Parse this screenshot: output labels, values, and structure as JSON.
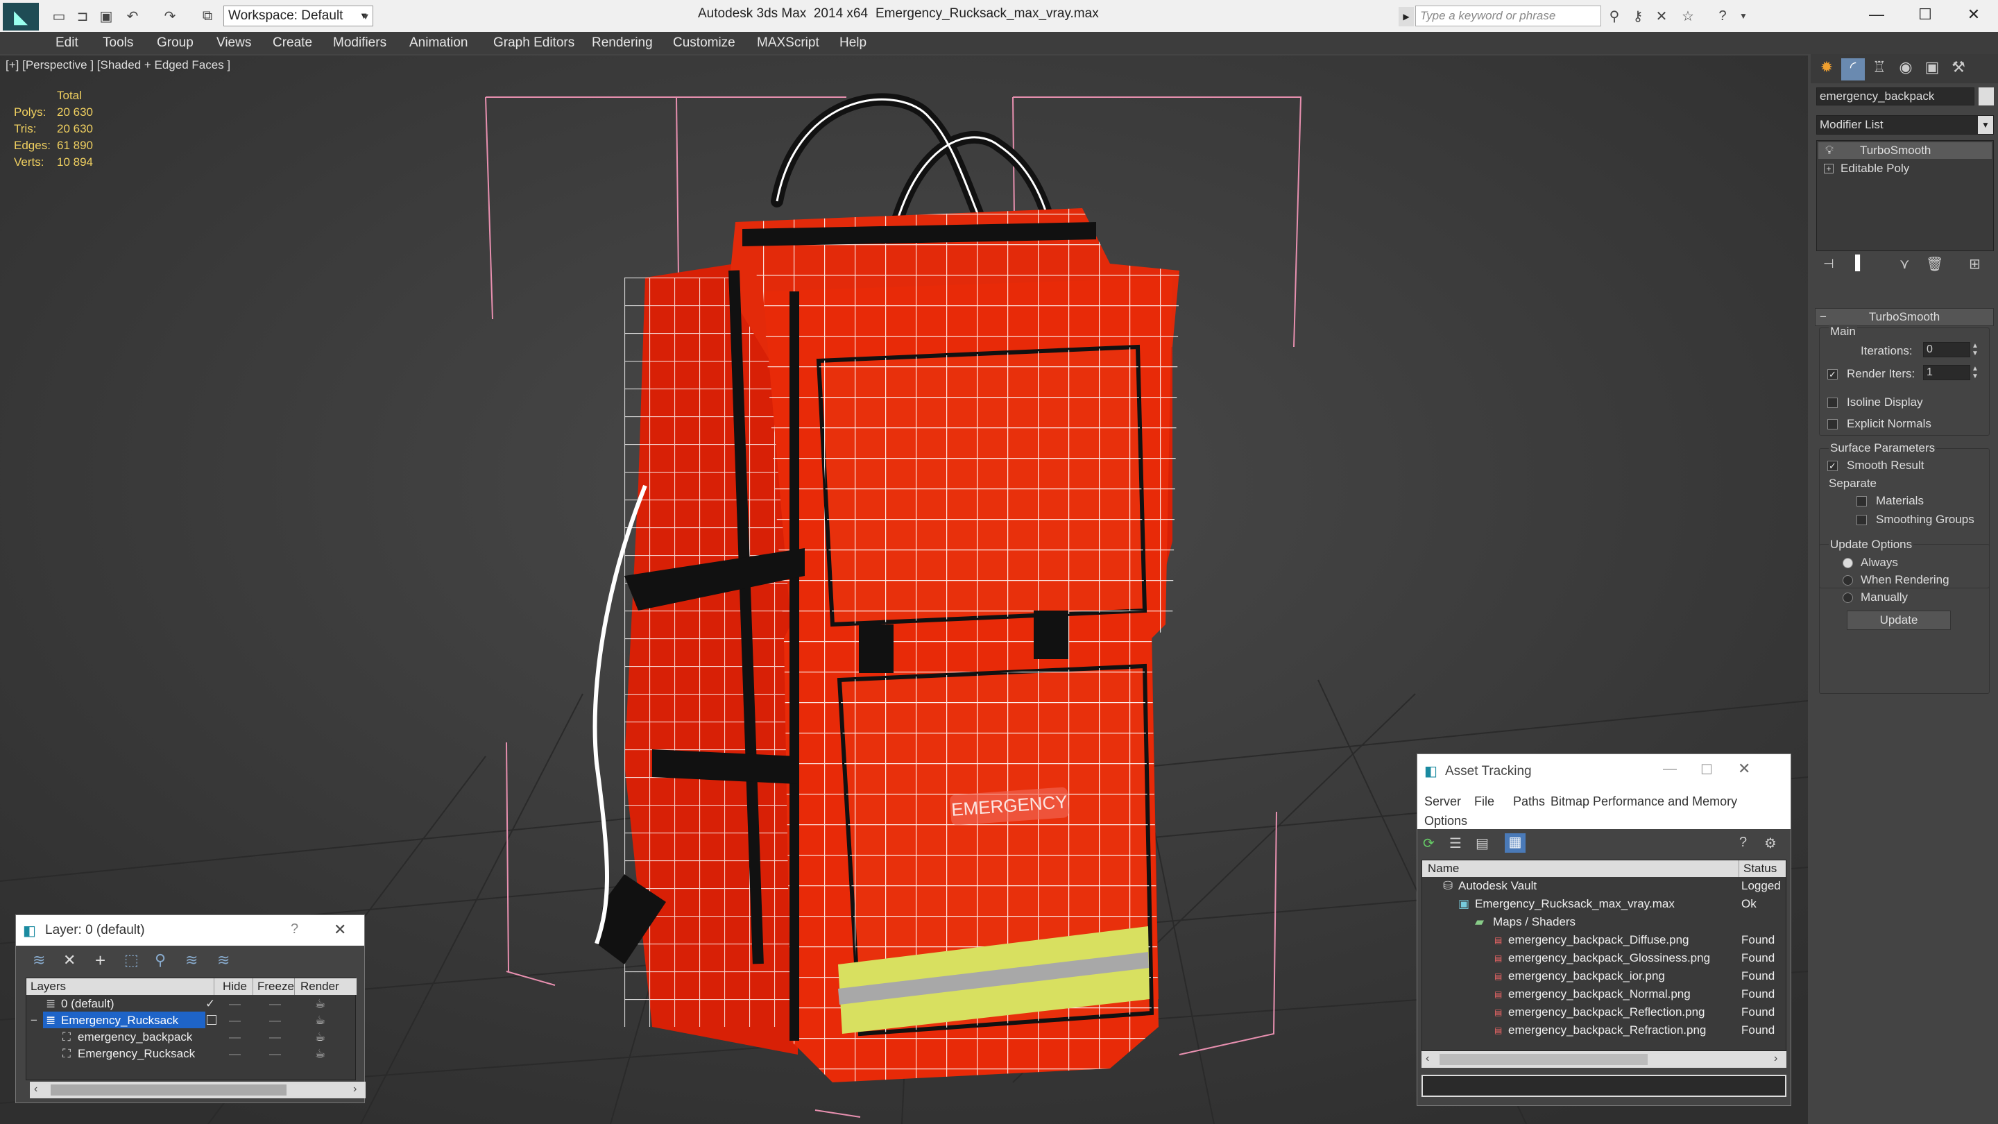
{
  "titlebar": {
    "app_title": "Autodesk 3ds Max  2014 x64",
    "file_name": "Emergency_Rucksack_max_vray.max",
    "workspace": "Workspace: Default",
    "search_placeholder": "Type a keyword or phrase"
  },
  "menu": [
    "Edit",
    "Tools",
    "Group",
    "Views",
    "Create",
    "Modifiers",
    "Animation",
    "Graph Editors",
    "Rendering",
    "Customize",
    "MAXScript",
    "Help"
  ],
  "viewport": {
    "label": "[+] [Perspective ] [Shaded + Edged Faces ]",
    "stats": {
      "header": "Total",
      "rows": [
        {
          "label": "Polys:",
          "value": "20 630"
        },
        {
          "label": "Tris:",
          "value": "20 630"
        },
        {
          "label": "Edges:",
          "value": "61 890"
        },
        {
          "label": "Verts:",
          "value": "10 894"
        }
      ]
    },
    "bag_logo": "EMERGENCY"
  },
  "command_panel": {
    "object_name": "emergency_backpack",
    "modifier_list": "Modifier List",
    "stack": [
      "TurboSmooth",
      "Editable Poly"
    ],
    "rollout_title": "TurboSmooth",
    "main_group": "Main",
    "iterations_label": "Iterations:",
    "iterations_value": "0",
    "render_iters_label": "Render Iters:",
    "render_iters_value": "1",
    "isoline_label": "Isoline Display",
    "explicit_normals_label": "Explicit Normals",
    "surface_group": "Surface Parameters",
    "smooth_result_label": "Smooth Result",
    "separate_label": "Separate",
    "materials_label": "Materials",
    "smoothing_groups_label": "Smoothing Groups",
    "update_group": "Update Options",
    "always_label": "Always",
    "when_rendering_label": "When Rendering",
    "manually_label": "Manually",
    "update_button": "Update"
  },
  "layer_dialog": {
    "title": "Layer: 0 (default)",
    "help": "?",
    "columns": [
      "Layers",
      "Hide",
      "Freeze",
      "Render"
    ],
    "rows": [
      "0 (default)",
      "Emergency_Rucksack",
      "emergency_backpack",
      "Emergency_Rucksack"
    ]
  },
  "asset_dialog": {
    "title": "Asset Tracking",
    "menu": [
      "Server",
      "File",
      "Paths",
      "Bitmap Performance and Memory",
      "Options"
    ],
    "columns": [
      "Name",
      "Status"
    ],
    "rows": [
      {
        "name": "Autodesk Vault",
        "status": "Logged"
      },
      {
        "name": "Emergency_Rucksack_max_vray.max",
        "status": "Ok"
      },
      {
        "name": "Maps / Shaders",
        "status": ""
      },
      {
        "name": "emergency_backpack_Diffuse.png",
        "status": "Found"
      },
      {
        "name": "emergency_backpack_Glossiness.png",
        "status": "Found"
      },
      {
        "name": "emergency_backpack_ior.png",
        "status": "Found"
      },
      {
        "name": "emergency_backpack_Normal.png",
        "status": "Found"
      },
      {
        "name": "emergency_backpack_Reflection.png",
        "status": "Found"
      },
      {
        "name": "emergency_backpack_Refraction.png",
        "status": "Found"
      }
    ]
  },
  "colors": {
    "bag_red": "#e82a08",
    "reflective_yellow": "#d8e060",
    "selection_blue": "#1e64c8",
    "stats_yellow": "#f0d060"
  }
}
